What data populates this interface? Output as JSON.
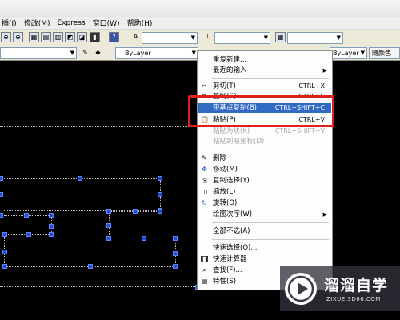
{
  "menubar": {
    "items": [
      "插(I)",
      "修改(M)",
      "Express",
      "窗口(W)",
      "帮助(H)"
    ]
  },
  "toolbar2": {
    "layer_combo": "ByLayer",
    "linetype_combo": "ByLayer",
    "lineweight_combo": "ByLayer",
    "plotstyle_combo": "随颜色"
  },
  "context_menu": {
    "repeat_new": "重复新建...",
    "recent_input": "最近的输入",
    "cut": "剪切(T)",
    "cut_shortcut": "CTRL+X",
    "copy": "复制(C)",
    "copy_shortcut": "CTRL+C",
    "copy_with_base": "带基点复制(B)",
    "copy_with_base_shortcut": "CTRL+SHIFT+C",
    "paste": "粘贴(P)",
    "paste_shortcut": "CTRL+V",
    "paste_as_block": "粘贴为块(K)",
    "paste_as_block_shortcut": "CTRL+SHIFT+V",
    "paste_original": "粘贴到原坐标(D)",
    "erase": "删除",
    "move": "移动(M)",
    "copy_selection": "复制选择(Y)",
    "scale": "缩放(L)",
    "rotate": "旋转(O)",
    "draw_order": "绘图次序(W)",
    "deselect_all": "全部不选(A)",
    "quick_select": "快速选择(Q)...",
    "quickcalc": "快速计算器",
    "find": "查找(F)...",
    "properties": "特性(S)"
  },
  "watermark": {
    "title": "溜溜自学",
    "subtitle": "ZIXUE.3D66.COM"
  }
}
